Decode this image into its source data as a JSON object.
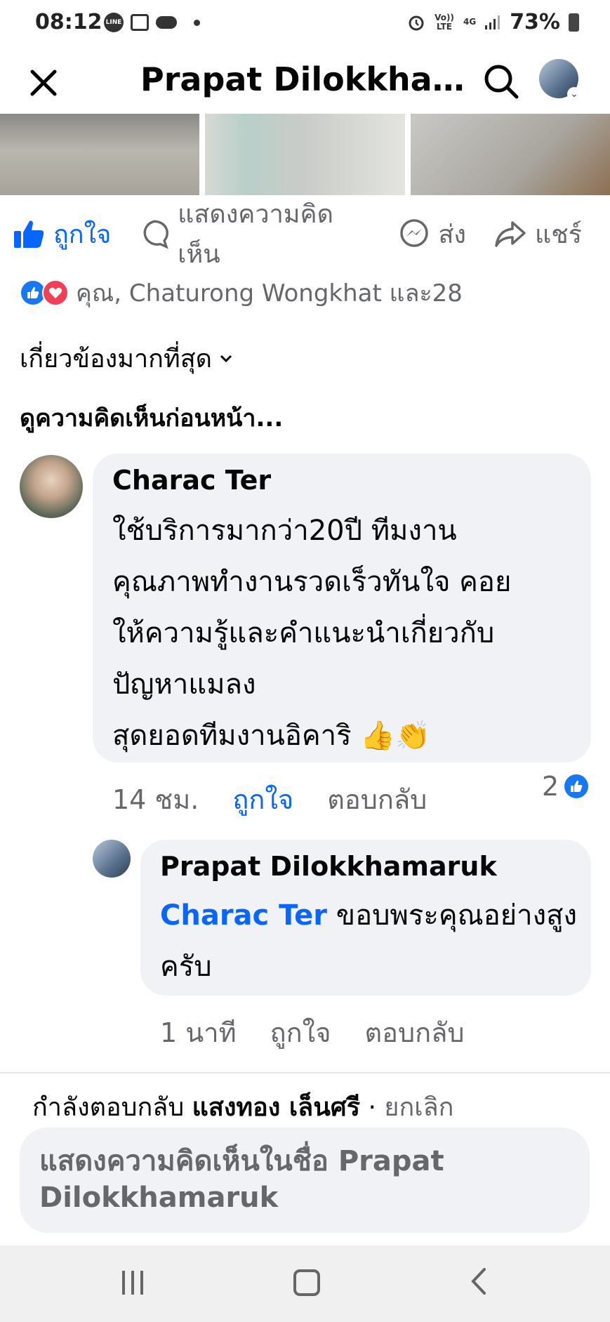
{
  "status_bar": {
    "time": "08:12",
    "line_icon_label": "LINE",
    "volte_label": "Vo)) LTE",
    "network_label": "4G",
    "battery": "73%"
  },
  "header": {
    "title": "Prapat Dilokkhama...",
    "close_icon": "close-icon",
    "search_icon": "search-icon"
  },
  "actions": {
    "like": "ถูกใจ",
    "comment": "แสดงความคิดเห็น",
    "send": "ส่ง",
    "share": "แชร์"
  },
  "reactions": {
    "summary": "คุณ, Chaturong Wongkhat และ28"
  },
  "sort_label": "เกี่ยวข้องมากที่สุด",
  "view_previous": "ดูความคิดเห็นก่อนหน้า...",
  "comment": {
    "author": "Charac Ter",
    "text": "ใช้บริการมากว่า20ปี ทีมงาน\nคุณภาพทำงานรวดเร็วทันใจ คอย\nให้ความรู้และคำแนะนำเกี่ยวกับ\nปัญหาแมลง\nสุดยอดทีมงานอิคาริ 👍👏",
    "time": "14 ชม.",
    "like_label": "ถูกใจ",
    "reply_label": "ตอบกลับ",
    "like_count": "2"
  },
  "reply": {
    "author": "Prapat Dilokkhamaruk",
    "mention": "Charac Ter",
    "text": " ขอบพระคุณอย่างสูงครับ",
    "time": "1 นาที",
    "like_label": "ถูกใจ",
    "reply_label": "ตอบกลับ"
  },
  "composer": {
    "replying_prefix": "กำลังตอบกลับ ",
    "replying_to": "แสงทอง เล็นศรี",
    "separator": " · ",
    "cancel": "ยกเลิก",
    "placeholder": "แสดงความคิดเห็นในชื่อ Prapat Dilokkhamaruk"
  },
  "colors": {
    "accent_blue": "#0866ff",
    "secondary_text": "#65676b",
    "bubble_bg": "#f0f2f5"
  }
}
